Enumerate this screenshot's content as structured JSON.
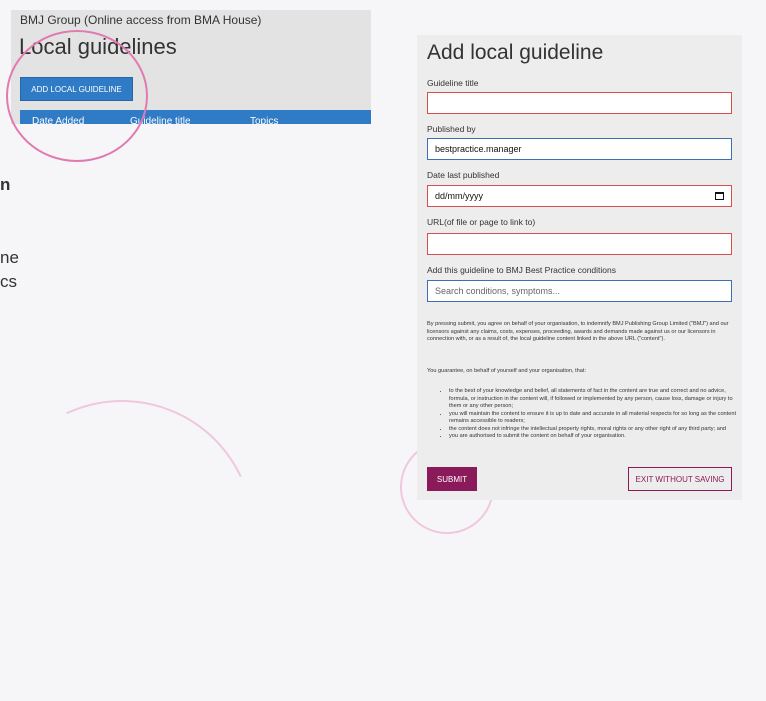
{
  "left": {
    "org": "BMJ Group (Online access from BMA House)",
    "title": "Local guidelines",
    "add_button": "ADD LOCAL GUIDELINE",
    "columns": [
      "Date Added",
      "Guideline title",
      "Topics"
    ],
    "fragments": [
      "n",
      "ne",
      "cs"
    ]
  },
  "form": {
    "title": "Add local guideline",
    "guideline_title_label": "Guideline title",
    "guideline_title_value": "",
    "published_by_label": "Published by",
    "published_by_value": "bestpractice.manager",
    "date_label": "Date last published",
    "date_placeholder": "dd/mm/yyyy",
    "url_label": "URL(of file or page to link to)",
    "url_value": "",
    "conditions_label": "Add this guideline to BMJ Best Practice conditions",
    "conditions_placeholder": "Search conditions, symptoms...",
    "legal_paragraph": "By pressing submit, you agree on behalf of your organisation, to indemnify BMJ Publishing Group Limited (\"BMJ\") and our licensors against any claims, costs, expenses, proceeding, awards and demands made against us or our licensors in connection with, or as a result of, the local guideline content linked in the above URL (\"content\").",
    "guarantee_intro": "You guarantee, on behalf of yourself and your organisation, that:",
    "bullets": [
      "to the best of your knowledge and belief, all statements of fact in the content are true and correct and no advice, formula, or instruction in the content will, if followed or implemented by any person, cause loss, damage or injury to them or any other person;",
      "you will maintain the content to ensure it is up to date and accurate in all material respects for so long as the content remains accessible to readers;",
      "the content does not infringe the intellectual property rights, moral rights or any other right of any third party; and",
      "you are authorised to submit the content on behalf of your organisation."
    ],
    "submit_label": "SUBMIT",
    "exit_label": "EXIT WITHOUT SAVING"
  },
  "colors": {
    "blue": "#2f7bc6",
    "brand": "#8b1a5a",
    "error": "#d45050",
    "highlight": "#e07ab0"
  }
}
